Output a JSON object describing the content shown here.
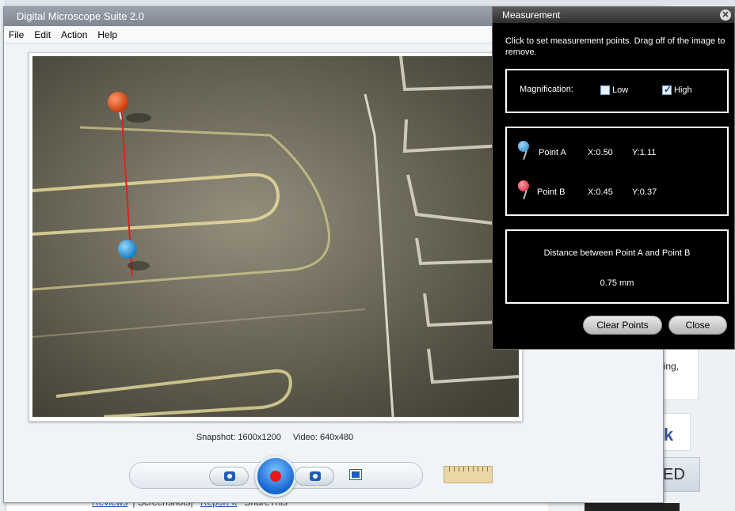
{
  "background": {
    "card_text": "ling,",
    "fb_text": "ook",
    "ed_text": "ED",
    "links": [
      "Reviews",
      "Screenshots",
      "Report It",
      "ShareThis"
    ]
  },
  "app": {
    "title": "Digital Microscope Suite 2.0",
    "menu": [
      "File",
      "Edit",
      "Action",
      "Help"
    ],
    "status": {
      "snapshot": "Snapshot: 1600x1200",
      "video": "Video: 640x480"
    }
  },
  "dialog": {
    "title": "Measurement",
    "close_glyph": "✕",
    "instructions": "Click to set measurement points. Drag off of the image to remove.",
    "magnification_label": "Magnification:",
    "options": [
      {
        "label": "Low",
        "checked": false
      },
      {
        "label": "High",
        "checked": true
      }
    ],
    "points": [
      {
        "name": "Point A",
        "x": "X:0.50",
        "y": "Y:1.11",
        "color": "#2f8fd6"
      },
      {
        "name": "Point B",
        "x": "X:0.45",
        "y": "Y:0.37",
        "color": "#d8283a"
      }
    ],
    "distance_label": "Distance between Point A and Point B",
    "distance_value": "0.75 mm",
    "buttons": {
      "clear": "Clear Points",
      "close": "Close"
    }
  },
  "colors": {
    "pin_top": "#e24a18",
    "pin_bottom": "#2a9ad8",
    "measure_line": "#e02020"
  }
}
